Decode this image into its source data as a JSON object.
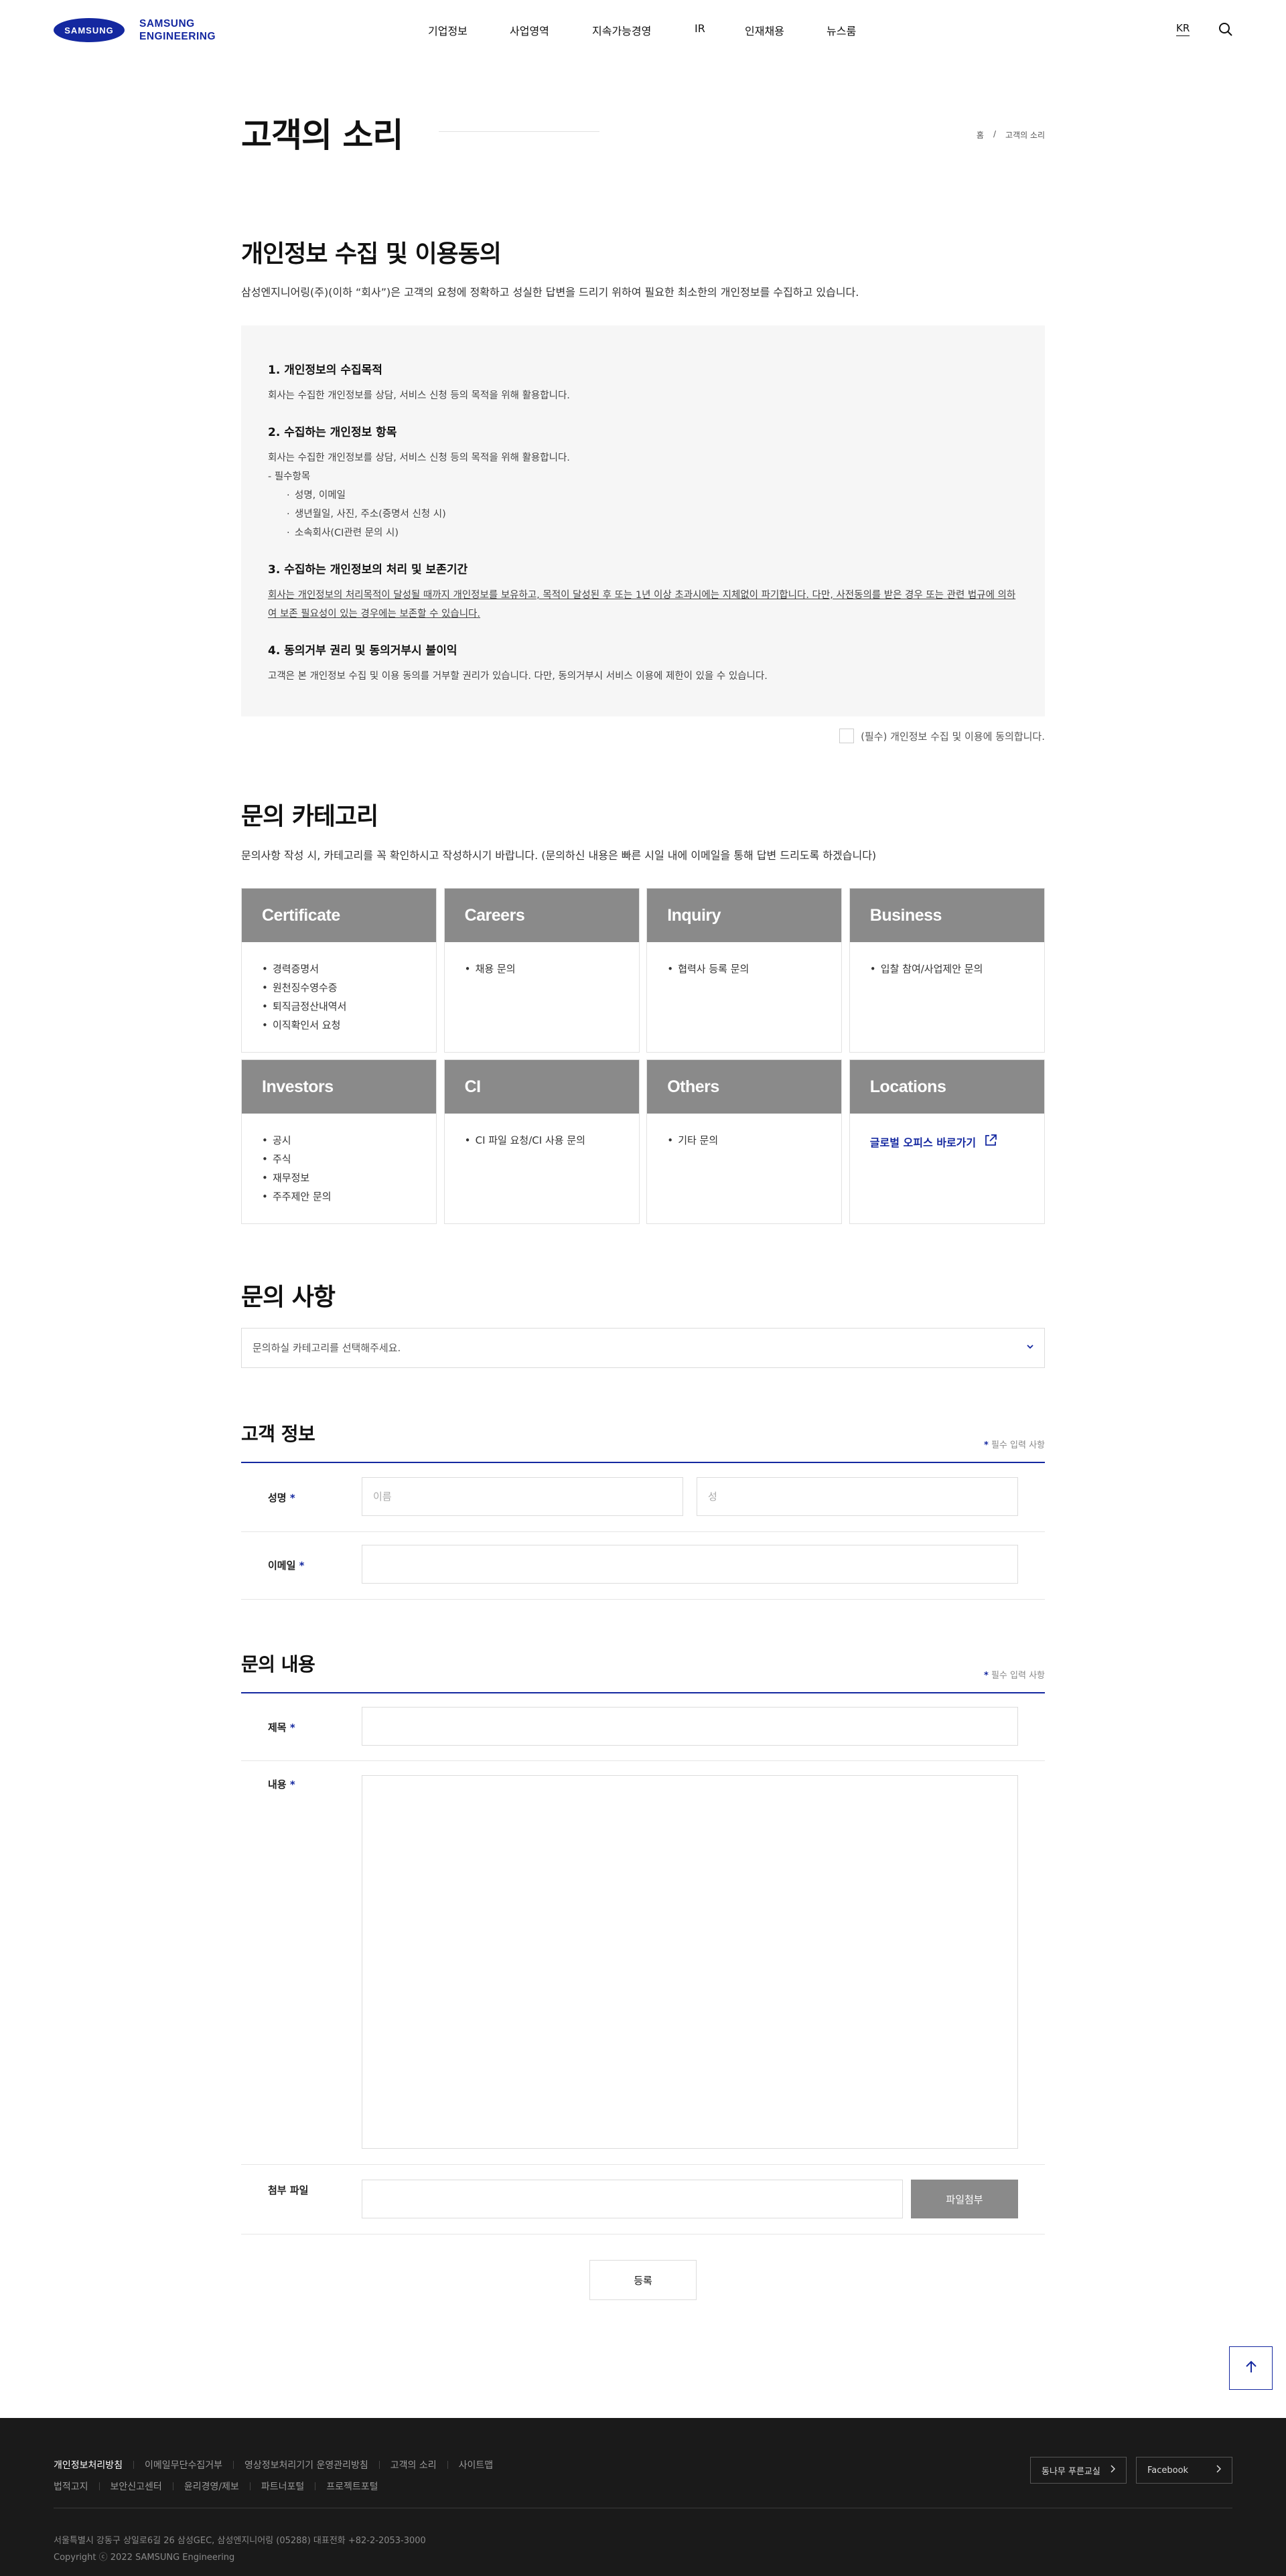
{
  "header": {
    "logo_mark": "SAMSUNG",
    "logo_line1": "SAMSUNG",
    "logo_line2": "ENGINEERING",
    "nav": [
      "기업정보",
      "사업영역",
      "지속가능경영",
      "IR",
      "인재채용",
      "뉴스룸"
    ],
    "lang": "KR"
  },
  "page": {
    "title": "고객의 소리",
    "breadcrumb": [
      "홈",
      "/",
      "고객의 소리"
    ]
  },
  "privacy": {
    "title": "개인정보 수집 및 이용동의",
    "desc": "삼성엔지니어링(주)(이하 “회사”)은 고객의 요청에 정확하고 성실한 답변을 드리기 위하여 필요한 최소한의 개인정보를 수집하고 있습니다.",
    "s1_title": "1. 개인정보의 수집목적",
    "s1_text": "회사는 수집한 개인정보를 상담, 서비스 신청 등의 목적을 위해 활용합니다.",
    "s2_title": "2. 수집하는 개인정보 항목",
    "s2_text": "회사는 수집한 개인정보를 상담, 서비스 신청 등의 목적을 위해 활용합니다.",
    "s2_required": "- 필수항목",
    "s2_items": [
      "성명, 이메일",
      "생년월일, 사진, 주소(증명서 신청 시)",
      "소속회사(CI관련 문의 시)"
    ],
    "s3_title": "3. 수집하는 개인정보의 처리 및 보존기간",
    "s3_text": "회사는 개인정보의 처리목적이 달성될 때까지 개인정보를 보유하고, 목적이 달성된 후 또는 1년 이상 초과시에는 지체없이 파기합니다. 다만, 사전동의를 받은 경우 또는 관련 법규에 의하여 보존 필요성이 있는 경우에는 보존할 수 있습니다.",
    "s4_title": "4. 동의거부 권리 및 동의거부시 불이익",
    "s4_text": "고객은 본 개인정보 수집 및 이용 동의를 거부할 권리가 있습니다. 다만, 동의거부시 서비스 이용에 제한이 있을 수 있습니다.",
    "agree_label": "(필수) 개인정보 수집 및 이용에 동의합니다."
  },
  "category": {
    "title": "문의 카테고리",
    "desc": "문의사항 작성 시, 카테고리를 꼭 확인하시고 작성하시기 바랍니다. (문의하신 내용은 빠른 시일 내에 이메일을 통해 답변 드리도록 하겠습니다)",
    "cards": [
      {
        "title": "Certificate",
        "items": [
          "경력증명서",
          "원천징수영수증",
          "퇴직금정산내역서",
          "이직확인서 요청"
        ]
      },
      {
        "title": "Careers",
        "items": [
          "채용 문의"
        ]
      },
      {
        "title": "Inquiry",
        "items": [
          "협력사 등록 문의"
        ]
      },
      {
        "title": "Business",
        "items": [
          "입찰 참여/사업제안 문의"
        ]
      },
      {
        "title": "Investors",
        "items": [
          "공시",
          "주식",
          "재무정보",
          "주주제안 문의"
        ]
      },
      {
        "title": "CI",
        "items": [
          "CI 파일 요청/CI 사용 문의"
        ]
      },
      {
        "title": "Others",
        "items": [
          "기타 문의"
        ]
      },
      {
        "title": "Locations",
        "link": "글로벌 오피스 바로가기"
      }
    ]
  },
  "inquiry": {
    "title": "문의 사항",
    "select_text": "문의하실 카테고리를 선택해주세요."
  },
  "customer": {
    "title": "고객 정보",
    "req_star": "*",
    "req_note": "필수 입력 사항",
    "name_label": "성명",
    "first_placeholder": "이름",
    "last_placeholder": "성",
    "email_label": "이메일"
  },
  "content": {
    "title": "문의 내용",
    "req_star": "*",
    "req_note": "필수 입력 사항",
    "subject_label": "제목",
    "body_label": "내용",
    "file_label": "첨부 파일",
    "file_button": "파일첨부",
    "submit": "등록"
  },
  "footer": {
    "links1": [
      "개인정보처리방침",
      "이메일무단수집거부",
      "영상정보처리기기 운영관리방침",
      "고객의 소리",
      "사이트맵"
    ],
    "links2": [
      "법적고지",
      "보안신고센터",
      "윤리경영/제보",
      "파트너포털",
      "프로젝트포털"
    ],
    "btn1": "동나무 푸른교실",
    "btn2": "Facebook",
    "address": "서울특별시 강동구 상일로6길 26 삼성GEC, 삼성엔지니어링 (05288) 대표전화 +82-2-2053-3000",
    "copyright": "Copyright ⓒ 2022 SAMSUNG Engineering"
  },
  "colors": {
    "brand": "#1428a0",
    "card_header": "#8a8a8a",
    "footer_bg": "#1a1a1a",
    "box_bg": "#f6f6f6"
  }
}
